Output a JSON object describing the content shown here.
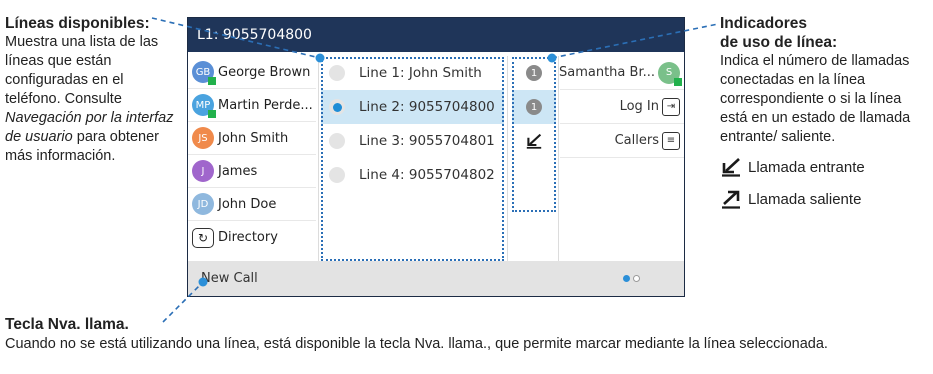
{
  "screen": {
    "title": "L1: 9055704800",
    "contacts": [
      {
        "initials": "GB",
        "name": "George Brown",
        "color": "#5a8fd6",
        "presence": true
      },
      {
        "initials": "MP",
        "name": "Martin Perde...",
        "color": "#4aa3df",
        "presence": true
      },
      {
        "initials": "JS",
        "name": "John Smith",
        "color": "#f08a4b",
        "presence": false
      },
      {
        "initials": "J",
        "name": "James",
        "color": "#a066cc",
        "presence": false
      },
      {
        "initials": "JD",
        "name": "John Doe",
        "color": "#8fb8de",
        "presence": false
      }
    ],
    "directory_label": "Directory",
    "lines": [
      {
        "label": "Line 1: John Smith",
        "selected": false
      },
      {
        "label": "Line 2: 9055704800",
        "selected": true
      },
      {
        "label": "Line 3: 9055704801",
        "selected": false
      },
      {
        "label": "Line 4: 9055704802",
        "selected": false
      }
    ],
    "line_indicators": [
      {
        "type": "count",
        "value": "1"
      },
      {
        "type": "count",
        "value": "1"
      },
      {
        "type": "incoming",
        "value": ""
      },
      {
        "type": "none",
        "value": ""
      }
    ],
    "softkeys": [
      {
        "label": "Samantha Br...",
        "icon": "avatar-icon",
        "initials": "S",
        "color": "#7ac08a"
      },
      {
        "label": "Log In",
        "icon": "login-icon"
      },
      {
        "label": "Callers",
        "icon": "callers-icon"
      }
    ],
    "new_call_label": "New Call",
    "page_indicator": {
      "total": 2,
      "active": 1
    }
  },
  "annotations": {
    "left": {
      "title": "Líneas disponibles:",
      "body_1": "Muestra una lista de las líneas que están configuradas en el teléfono. Consulte",
      "body_italic": "Navegación por la interfaz de usuario",
      "body_2": "para obtener más información."
    },
    "right": {
      "title_1": "Indicadores",
      "title_2": "de uso de línea:",
      "body": "Indica el número de llamadas conectadas en la línea correspondiente o si la línea está en un estado de llamada entrante/ saliente.",
      "incoming_label": "Llamada entrante",
      "outgoing_label": "Llamada saliente"
    },
    "bottom": {
      "title": "Tecla Nva. llama.",
      "body": "Cuando no se está utilizando una línea, está disponible la tecla Nva. llama., que permite marcar mediante la línea seleccionada."
    }
  },
  "colors": {
    "titlebar": "#1f3559",
    "selection": "#cde6f5",
    "accent": "#2b8fd8",
    "frame": "#2b6fb6"
  }
}
